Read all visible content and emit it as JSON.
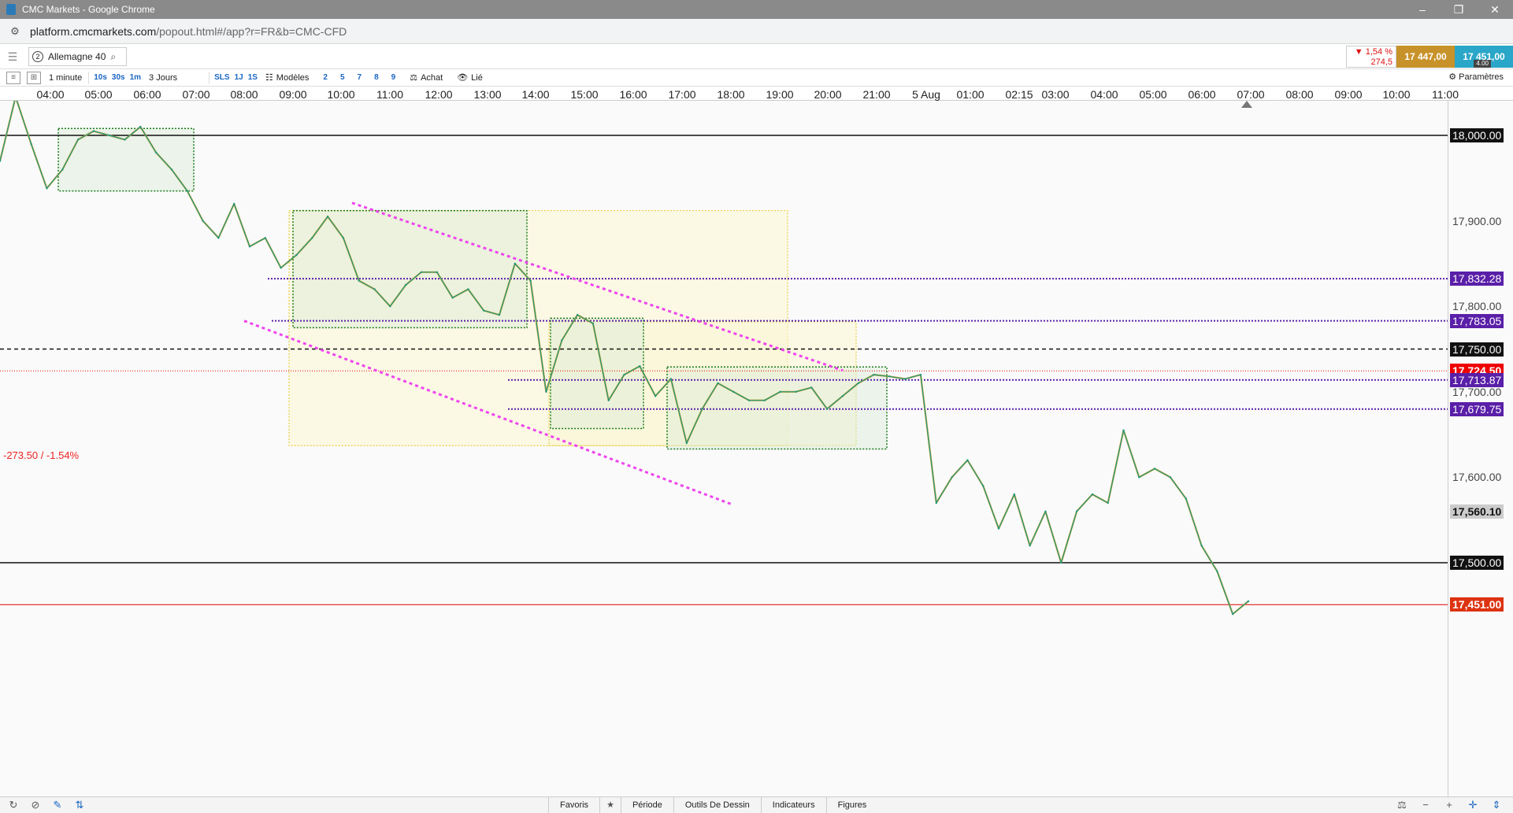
{
  "window": {
    "title": "CMC Markets - Google Chrome",
    "controls": [
      "–",
      "❐",
      "✕"
    ]
  },
  "address": {
    "host": "platform.cmcmarkets.com",
    "path": "/popout.html#/app?r=FR&b=CMC-CFD"
  },
  "toolbar1": {
    "instrument_number": "2",
    "instrument_name": "Allemagne 40",
    "change_pct": "▼ 1,54 %",
    "change_pts": "274,5",
    "sell_price": "17 447,00",
    "buy_price": "17 451,00",
    "spread": "4.00"
  },
  "toolbar2": {
    "interval": "1 minute",
    "interval_options": [
      "10s",
      "30s",
      "1m"
    ],
    "range": "3 Jours",
    "range_options": [
      "SLS",
      "1J",
      "1S"
    ],
    "models": "Modèles",
    "model_numbers": [
      "2",
      "5",
      "7",
      "8",
      "9"
    ],
    "buy": "Achat",
    "linked": "Lié",
    "settings": "Paramètres"
  },
  "time_axis": [
    "04:00",
    "05:00",
    "06:00",
    "07:00",
    "08:00",
    "09:00",
    "10:00",
    "11:00",
    "12:00",
    "13:00",
    "14:00",
    "15:00",
    "16:00",
    "17:00",
    "18:00",
    "19:00",
    "20:00",
    "21:00",
    "5 Aug",
    "01:00",
    "02:15",
    "03:00",
    "04:00",
    "05:00",
    "06:00",
    "07:00",
    "08:00",
    "09:00",
    "10:00",
    "11:00"
  ],
  "price_axis": {
    "ticks": [
      "17,900.00",
      "17,800.00",
      "17,700.00",
      "17,600.00"
    ],
    "levels": [
      {
        "value": "18,000.00",
        "style": "black"
      },
      {
        "value": "17,832.28",
        "style": "purple"
      },
      {
        "value": "17,783.05",
        "style": "purple"
      },
      {
        "value": "17,750.00",
        "style": "black"
      },
      {
        "value": "17,724.50",
        "style": "red"
      },
      {
        "value": "17,713.87",
        "style": "purple"
      },
      {
        "value": "17,679.75",
        "style": "purple"
      },
      {
        "value": "17,560.10",
        "style": "grey"
      },
      {
        "value": "17,500.00",
        "style": "black"
      },
      {
        "value": "17,451.00",
        "style": "darkred"
      }
    ]
  },
  "change_note": "-273.50 / -1.54%",
  "chart_data": {
    "type": "line",
    "instrument": "Allemagne 40",
    "interval": "1 minute",
    "y_range": [
      17410,
      18080
    ],
    "series": [
      {
        "values": [
          17970,
          18045,
          17990,
          17938,
          17960,
          17995,
          18005,
          18000,
          17995,
          18010,
          17980,
          17960,
          17935,
          17900,
          17880,
          17920,
          17870,
          17880,
          17845,
          17860,
          17880,
          17905,
          17880,
          17830,
          17820,
          17800,
          17825,
          17840,
          17840,
          17810,
          17820,
          17795,
          17790,
          17850,
          17830,
          17700,
          17760,
          17790,
          17780,
          17690,
          17720,
          17730,
          17695,
          17715,
          17640,
          17680,
          17710,
          17700,
          17690,
          17690,
          17700,
          17700,
          17705,
          17680,
          17695,
          17710,
          17720,
          17718,
          17715,
          17720,
          17570,
          17600,
          17620,
          17590,
          17540,
          17580,
          17520,
          17560,
          17500,
          17560,
          17580,
          17570,
          17655,
          17600,
          17610,
          17600,
          17575,
          17520,
          17490,
          17440,
          17455
        ]
      }
    ],
    "horizontal_levels": [
      18000,
      17832.28,
      17783.05,
      17750,
      17724.5,
      17713.87,
      17679.75,
      17500,
      17451
    ]
  },
  "bottombar": {
    "tabs": [
      "Favoris",
      "★",
      "Période",
      "Outils De Dessin",
      "Indicateurs",
      "Figures"
    ]
  },
  "colors": {
    "price_line": "#1a9a8a",
    "price_line_alt": "#d4a020",
    "support": "#111111",
    "fib": "#5a1fa8",
    "current": "#e00000",
    "channel": "#ee44ee",
    "box_green": "#1a7a1a",
    "box_yellow": "#e8d040"
  }
}
